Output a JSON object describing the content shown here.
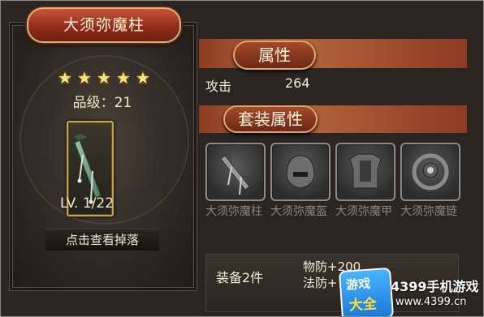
{
  "item": {
    "title": "大须弥魔柱",
    "stars": 5,
    "grade": "品级：21",
    "level": "LV. 1/22",
    "drop_button": "点击查看掉落"
  },
  "attributes": {
    "header": "属性",
    "stat_label": "攻击",
    "stat_value": "264"
  },
  "suit": {
    "header": "套装属性",
    "pieces": [
      {
        "name": "大须弥魔柱",
        "icon": "staff-icon"
      },
      {
        "name": "大须弥魔盔",
        "icon": "helmet-icon"
      },
      {
        "name": "大须弥魔甲",
        "icon": "armor-icon"
      },
      {
        "name": "大须弥魔链",
        "icon": "chain-icon"
      }
    ],
    "bonus": {
      "label": "装备2件",
      "line1": "物防+200",
      "line2": "法防+"
    }
  },
  "watermark": {
    "badge_top": "游戏",
    "badge_bottom": "大全",
    "site_name": "4399手机游戏",
    "site_url": "www.4399.cn"
  },
  "colors": {
    "accent": "#c8553a",
    "gold": "#c9a24c",
    "text": "#f2ecd8",
    "muted": "#8b8682"
  }
}
